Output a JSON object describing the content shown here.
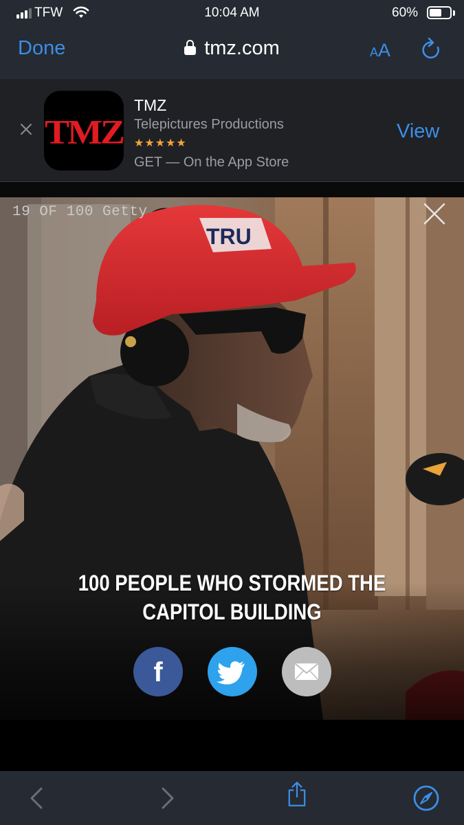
{
  "status_bar": {
    "carrier": "TFW",
    "time": "10:04 AM",
    "battery_percent": "60%",
    "battery_level": 0.6,
    "signal_bars_filled": 3
  },
  "browser": {
    "done_label": "Done",
    "url": "tmz.com",
    "text_size_small": "A",
    "text_size_large": "A",
    "accent_color": "#3d8ee8"
  },
  "app_banner": {
    "close_glyph": "×",
    "icon_text": "TMZ",
    "app_name": "TMZ",
    "publisher": "Telepictures Productions",
    "rating_stars": "★★★★★",
    "cta": "GET — On the App Store",
    "view_label": "View"
  },
  "gallery": {
    "counter": "19 OF 100 Getty",
    "headline": "100 PEOPLE WHO STORMED THE CAPITOL BUILDING",
    "photo_cap_text": "TRU",
    "share": {
      "facebook_glyph": "f"
    }
  },
  "toolbar": {
    "icons": [
      "back-icon",
      "forward-icon",
      "share-icon",
      "compass-icon"
    ]
  }
}
